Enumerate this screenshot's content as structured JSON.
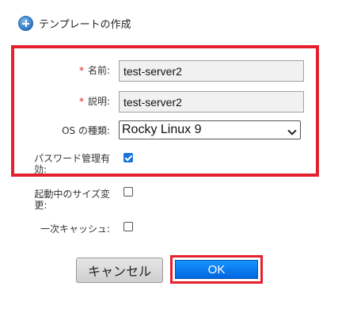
{
  "dialog": {
    "title": "テンプレートの作成",
    "icon": "plus-circle-icon"
  },
  "form": {
    "required_mark": "*",
    "name": {
      "label": "名前:",
      "value": "test-server2"
    },
    "description": {
      "label": "説明:",
      "value": "test-server2"
    },
    "os_type": {
      "label": "OS の種類:",
      "selected": "Rocky Linux 9"
    },
    "password_management": {
      "label_line1": "パスワード管理有",
      "label_line2": "効:",
      "checked": true
    },
    "resize_while_running": {
      "label_line1": "起動中のサイズ変",
      "label_line2": "更:",
      "checked": false
    },
    "primary_cache": {
      "label": "一次キャッシュ:",
      "checked": false
    }
  },
  "buttons": {
    "cancel_label": "キャンセル",
    "ok_label": "OK"
  },
  "colors": {
    "highlight": "#e5202e",
    "ok_button": "#0a7bf0",
    "required": "#e02020"
  }
}
